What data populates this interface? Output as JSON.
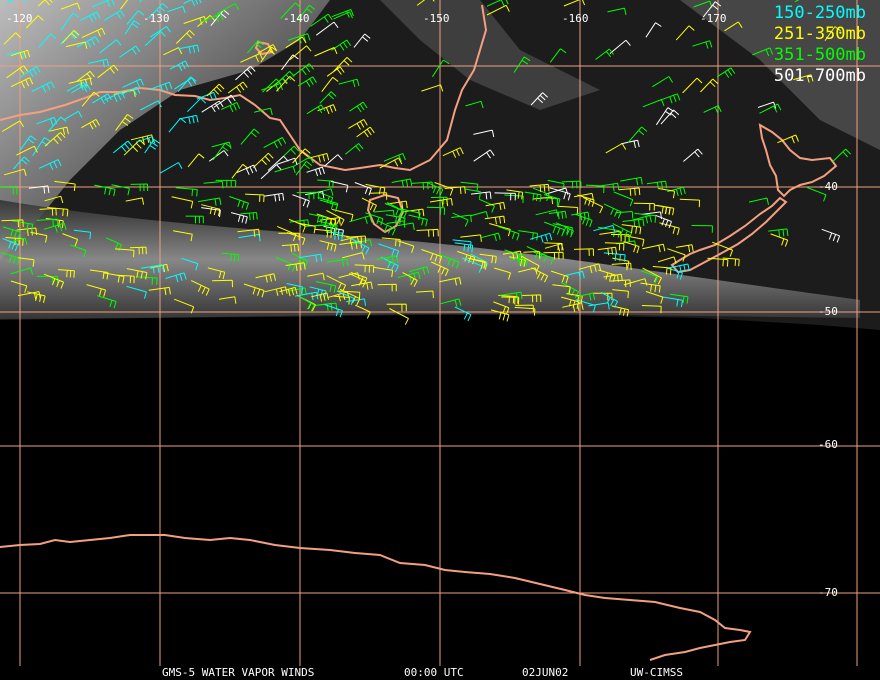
{
  "map": {
    "longitude_labels": [
      "-120",
      "-130",
      "-140",
      "-150",
      "-160",
      "-170"
    ],
    "latitude_labels": [
      "-40",
      "-50",
      "-60",
      "-70"
    ]
  },
  "legend": [
    {
      "label": "150-250mb",
      "color": "#00ffff"
    },
    {
      "label": "251-350mb",
      "color": "#ffff00"
    },
    {
      "label": "351-500mb",
      "color": "#00ff00"
    },
    {
      "label": "501-700mb",
      "color": "#ffffff"
    }
  ],
  "footer": {
    "product": "GMS-5 WATER VAPOR WINDS",
    "time": "00:00 UTC",
    "date": "02JUN02",
    "source": "UW-CIMSS"
  },
  "colors": {
    "grid": "#f0a080",
    "coastline": "#f4a080",
    "imagery_light": "#d8d8d8",
    "imagery_dark": "#1a1a1a"
  }
}
